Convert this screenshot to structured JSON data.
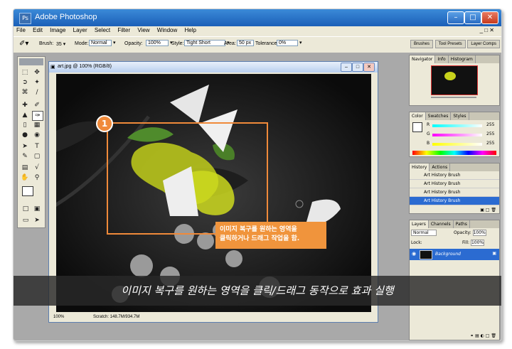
{
  "window": {
    "title": "Adobe Photoshop",
    "logo": "Ps"
  },
  "menu": {
    "items": [
      "File",
      "Edit",
      "Image",
      "Layer",
      "Select",
      "Filter",
      "View",
      "Window",
      "Help"
    ]
  },
  "options": {
    "brush_label": "Brush:",
    "brush_size": "35",
    "mode_label": "Mode:",
    "mode_value": "Normal",
    "opacity_label": "Opacity:",
    "opacity_value": "100%",
    "style_label": "Style:",
    "style_value": "Tight Short",
    "area_label": "Area:",
    "area_value": "50 px",
    "tolerance_label": "Tolerance:",
    "tolerance_value": "0%",
    "tabs": [
      "Brushes",
      "Tool Presets",
      "Layer Comps"
    ]
  },
  "document": {
    "title": "art.jpg @ 100% (RGB/8)",
    "zoom": "100%",
    "scratch": "Scratch: 148.7M/934.7M"
  },
  "navigator": {
    "tabs": [
      "Navigator",
      "Info",
      "Histogram"
    ]
  },
  "color": {
    "tabs": [
      "Color",
      "Swatches",
      "Styles"
    ],
    "r_label": "R",
    "r_value": "255",
    "g_label": "G",
    "g_value": "255",
    "b_label": "B",
    "b_value": "255"
  },
  "history": {
    "tabs": [
      "History",
      "Actions"
    ],
    "rows": [
      "Art History Brush",
      "Art History Brush",
      "Art History Brush",
      "Art History Brush"
    ]
  },
  "layers": {
    "tabs": [
      "Layers",
      "Channels",
      "Paths"
    ],
    "mode": "Normal",
    "opacity_label": "Opacity:",
    "opacity_value": "100%",
    "lock_label": "Lock:",
    "fill_label": "Fill:",
    "fill_value": "100%",
    "layer_name": "Background"
  },
  "annotation": {
    "badge": "1",
    "tooltip_line1": "이미지 복구를 원하는 영역을",
    "tooltip_line2": "클릭하거나 드래그 작업을 함.",
    "banner": "이미지 복구를 원하는 영역을 클릭/드래그 동작으로 효과 실행",
    "accent_color": "#f08a3a"
  }
}
